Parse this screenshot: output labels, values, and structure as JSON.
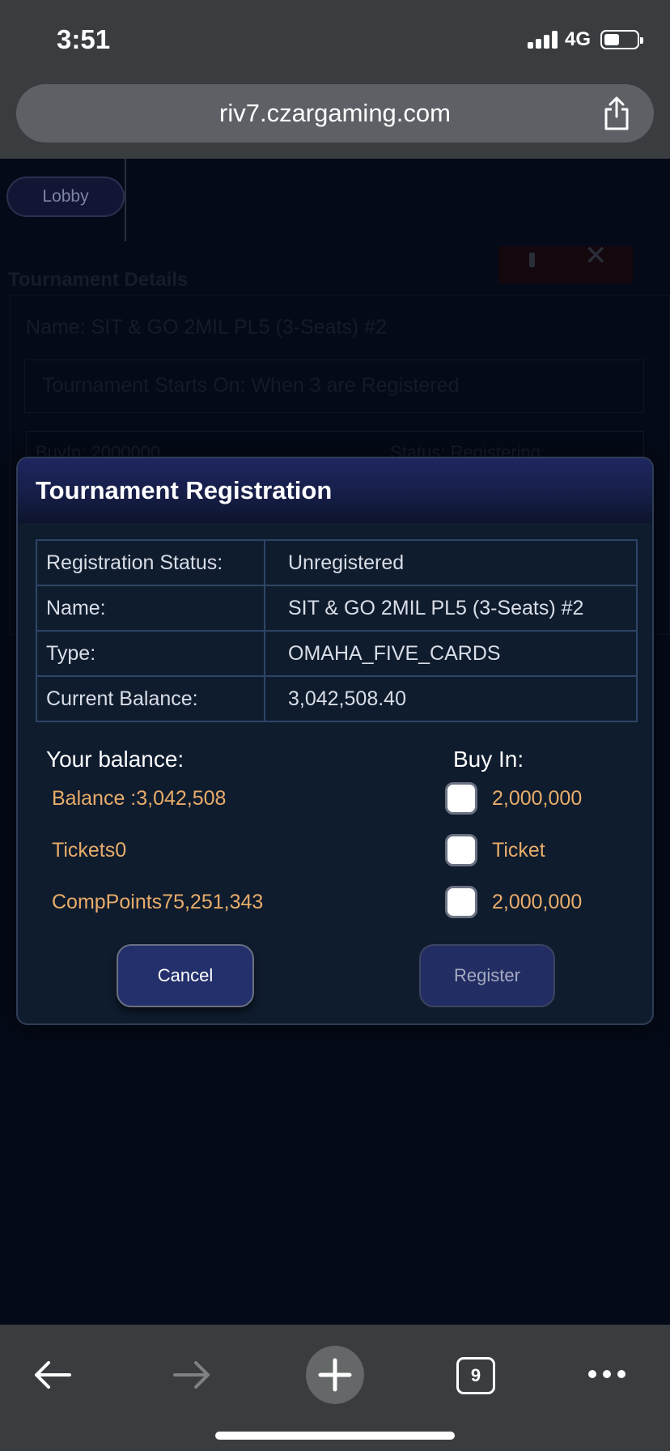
{
  "status_bar": {
    "time": "3:51",
    "network": "4G",
    "battery_level": 0.45
  },
  "browser": {
    "url": "riv7.czargaming.com",
    "open_tabs_count": "9"
  },
  "background_page": {
    "lobby_label": "Lobby",
    "section_title": "Tournament Details",
    "name_line": "Name: SIT & GO 2MIL PL5 (3-Seats) #2",
    "starts_line": "Tournament Starts On: When 3 are Registered",
    "buyin_line": "BuyIn:  2000000",
    "status_line": "Status:  Registering"
  },
  "modal": {
    "title": "Tournament Registration",
    "info_rows": [
      {
        "label": "Registration Status:",
        "value": "Unregistered"
      },
      {
        "label": "Name:",
        "value": "SIT & GO 2MIL PL5 (3-Seats) #2"
      },
      {
        "label": "Type:",
        "value": "OMAHA_FIVE_CARDS"
      },
      {
        "label": "Current Balance:",
        "value": "3,042,508.40"
      }
    ],
    "your_balance_heading": "Your balance:",
    "balances": [
      "Balance :3,042,508",
      "Tickets0",
      "CompPoints75,251,343"
    ],
    "buy_in_heading": "Buy In:",
    "buy_in_options": [
      {
        "label": "2,000,000",
        "checked": false
      },
      {
        "label": "Ticket",
        "checked": false
      },
      {
        "label": "2,000,000",
        "checked": false
      }
    ],
    "cancel_label": "Cancel",
    "register_label": "Register"
  },
  "colors": {
    "accent_orange": "#e8ac6a",
    "modal_bg": "#0f1c2e",
    "button_blue": "#23306b"
  }
}
